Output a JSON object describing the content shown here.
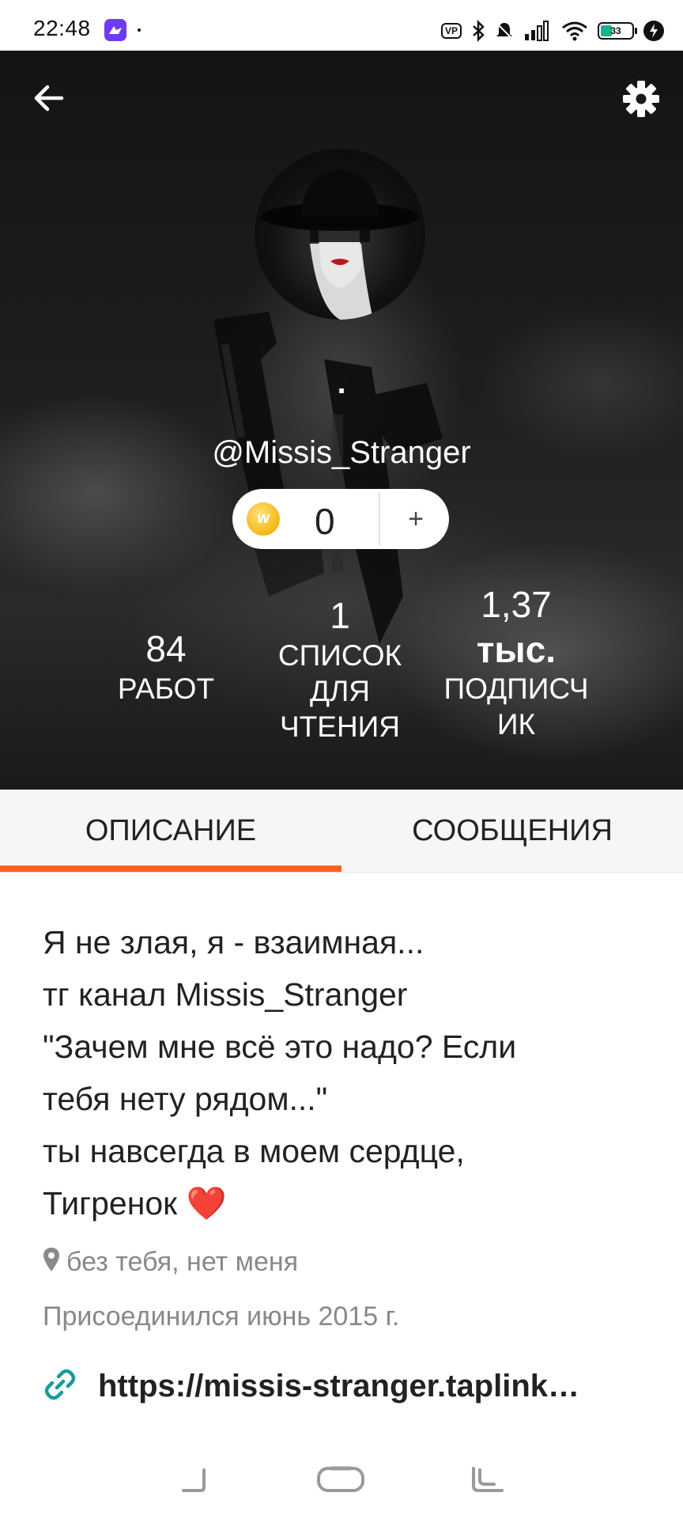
{
  "status_bar": {
    "time": "22:48",
    "vpn_label": "VP",
    "battery_percent": "33",
    "battery_color": "#17b38e"
  },
  "header": {
    "display_name": ".",
    "username": "@Missis_Stranger",
    "coins": {
      "count": "0",
      "add_label": "+",
      "coin_letter": "w"
    },
    "stats": {
      "works": {
        "value": "84",
        "label": "РАБОТ"
      },
      "reading_lists": {
        "value": "1",
        "label": [
          "СПИСОК",
          "ДЛЯ",
          "ЧТЕНИЯ"
        ]
      },
      "followers": {
        "value_line1": "1,37",
        "value_line2": "тыс.",
        "label": [
          "ПОДПИСЧ",
          "ИК"
        ]
      }
    }
  },
  "tabs": [
    {
      "label": "ОПИСАНИЕ",
      "active": true
    },
    {
      "label": "СООБЩЕНИЯ",
      "active": false
    }
  ],
  "accent_color": "#ff6122",
  "description": {
    "bio_lines": [
      "Я не злая, я - взаимная...",
      "тг канал Missis_Stranger",
      "\"Зачем мне всё это надо? Если",
      "тебя нету рядом...\"",
      "ты навсегда в моем сердце,",
      "Тигренок"
    ],
    "heart_emoji": "❤️",
    "location": "без тебя, нет меня",
    "joined": "Присоединился июнь 2015 г.",
    "link": "https://missis-stranger.taplink…"
  },
  "icons": {
    "back": "arrow-left-icon",
    "settings": "gear-icon",
    "location": "map-pin-icon",
    "link": "link-icon"
  }
}
